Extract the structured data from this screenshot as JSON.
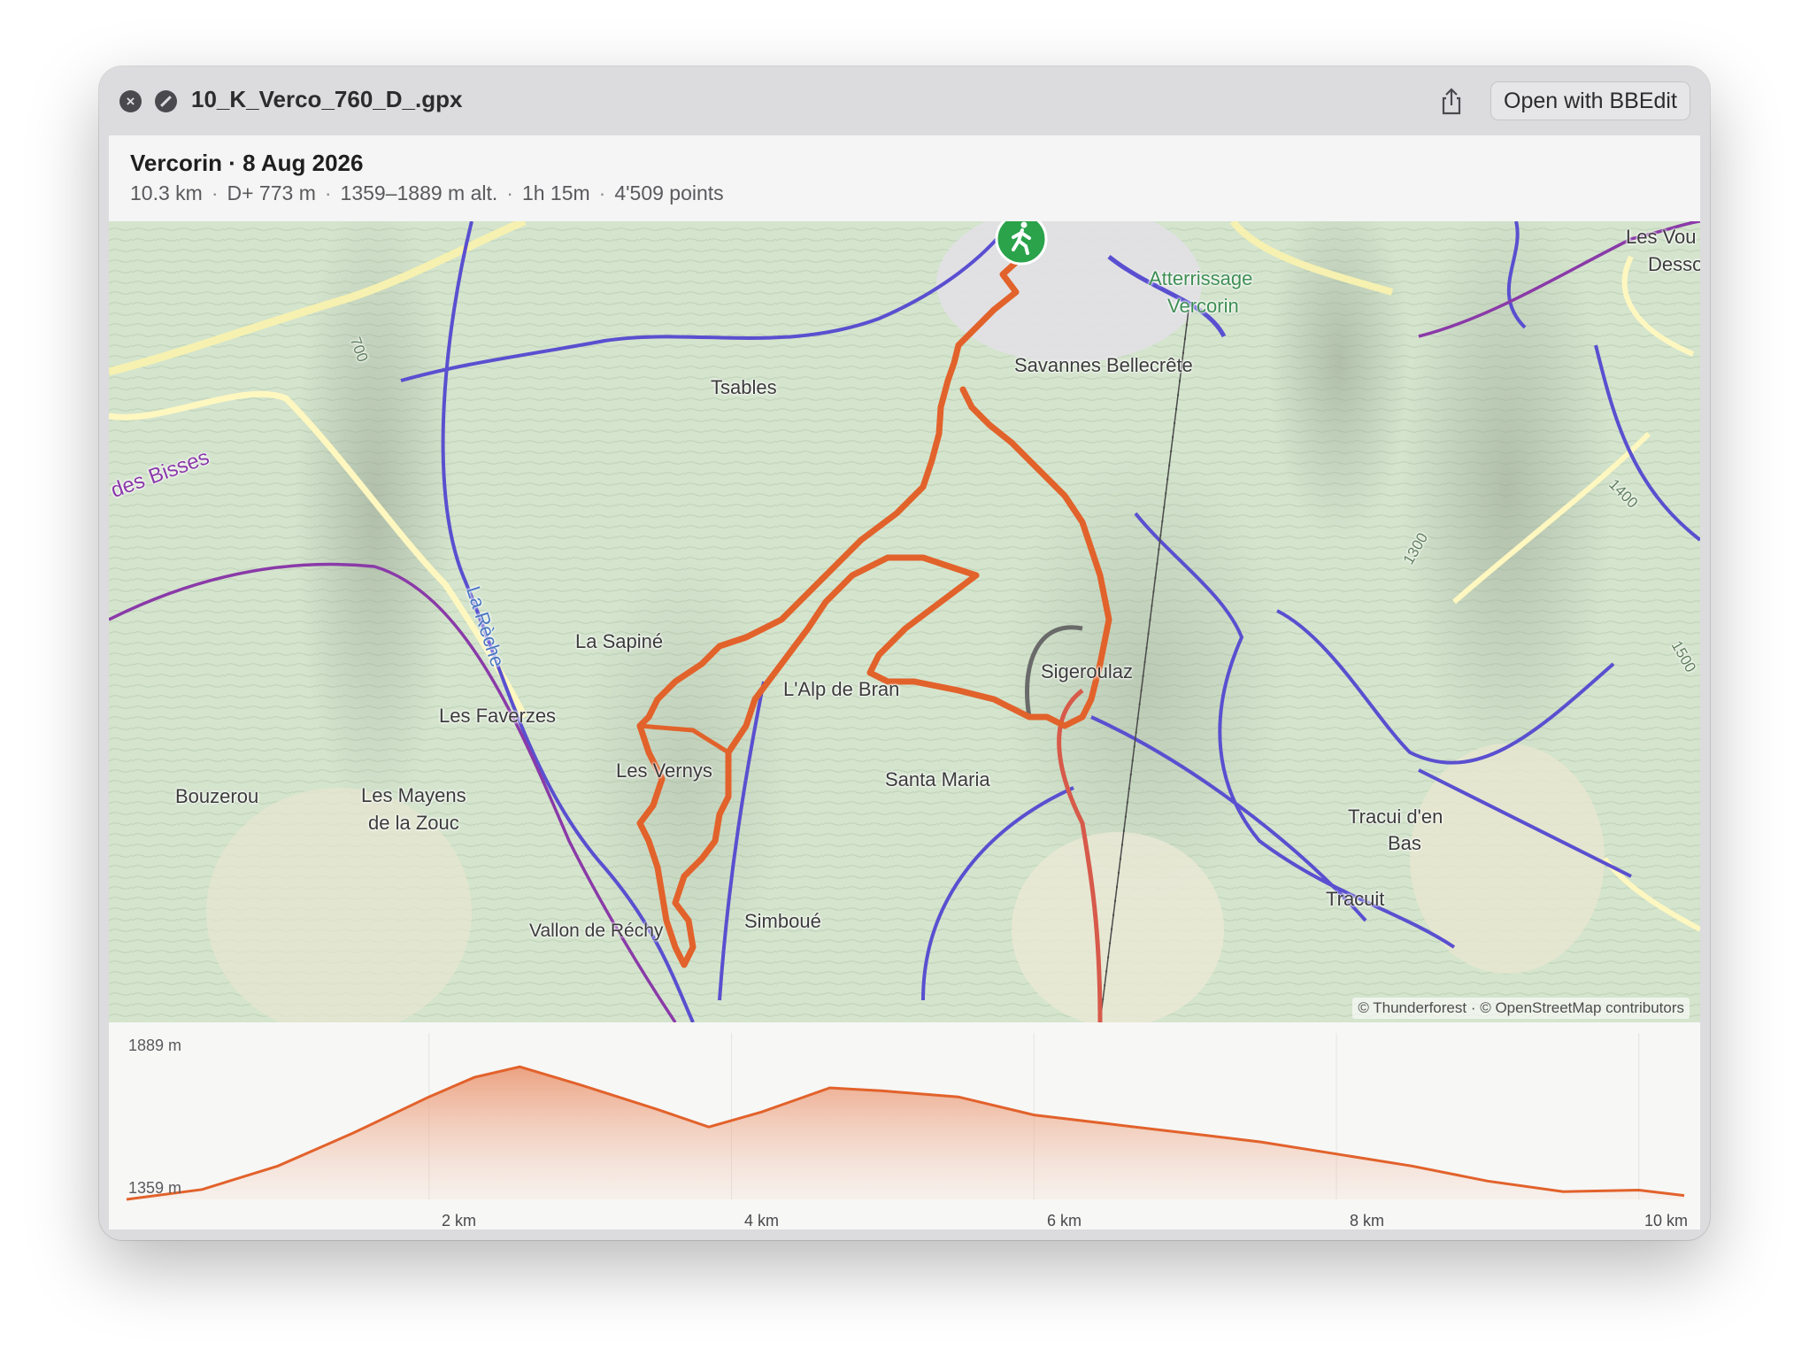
{
  "window": {
    "filename": "10_K_Verco_760_D_.gpx",
    "open_button": "Open with BBEdit"
  },
  "trip": {
    "title": "Vercorin · 8 Aug 2026",
    "distance": "10.3 km",
    "ascent": "D+ 773 m",
    "altitude_range": "1359–1889 m alt.",
    "duration": "1h 15m",
    "points": "4'509 points"
  },
  "map": {
    "attribution": "© Thunderforest · © OpenStreetMap contributors",
    "start_icon": "hiker-icon",
    "places": {
      "tsables": "Tsables",
      "savannes": "Savannes Bellecrête",
      "atterrissage_1": "Atterrissage",
      "atterrissage_2": "Vercorin",
      "les_vou_1": "Les Vou",
      "les_vou_2": "Desso",
      "bisses": "des Bisses",
      "la_reche": "La Rèche",
      "la_sapine": "La Sapiné",
      "alp_de_bran": "L'Alp de Bran",
      "sigeroulaz": "Sigeroulaz",
      "les_faverzes": "Les Faverzes",
      "les_vernys": "Les Vernys",
      "santa_maria": "Santa Maria",
      "bouzerou": "Bouzerou",
      "mayens_1": "Les Mayens",
      "mayens_2": "de la Zouc",
      "tracui_1": "Tracui d'en",
      "tracui_2": "Bas",
      "tracuit": "Tracuit",
      "simboue": "Simboué",
      "vallon": "Vallon de Réchy",
      "contour_700": "700",
      "contour_1300": "1300",
      "contour_1400": "1400",
      "contour_1500": "1500"
    },
    "colors": {
      "track": "#e2622b",
      "trail": "#5a4fd0",
      "route": "#8a3aa8"
    }
  },
  "elevation": {
    "max_label": "1889 m",
    "min_label": "1359 m",
    "km_labels": [
      "2 km",
      "4 km",
      "6 km",
      "8 km",
      "10 km"
    ]
  },
  "chart_data": {
    "type": "area",
    "x": [
      0,
      0.5,
      1,
      1.5,
      2,
      2.3,
      2.6,
      3,
      3.5,
      3.85,
      4.2,
      4.65,
      5,
      5.5,
      6,
      6.5,
      7,
      7.5,
      8,
      8.5,
      9,
      9.5,
      10,
      10.3
    ],
    "series": [
      {
        "values": [
          1359,
          1392,
          1470,
          1580,
          1700,
          1765,
          1800,
          1740,
          1660,
          1600,
          1650,
          1730,
          1720,
          1700,
          1640,
          1610,
          1580,
          1550,
          1510,
          1470,
          1420,
          1385,
          1390,
          1372
        ]
      }
    ],
    "xlim": [
      0,
      10.3
    ],
    "ylim": [
      1359,
      1889
    ],
    "x_ticks": [
      "2 km",
      "4 km",
      "6 km",
      "8 km",
      "10 km"
    ],
    "y_ticks": [
      "1359 m",
      "1889 m"
    ],
    "grid": true
  }
}
